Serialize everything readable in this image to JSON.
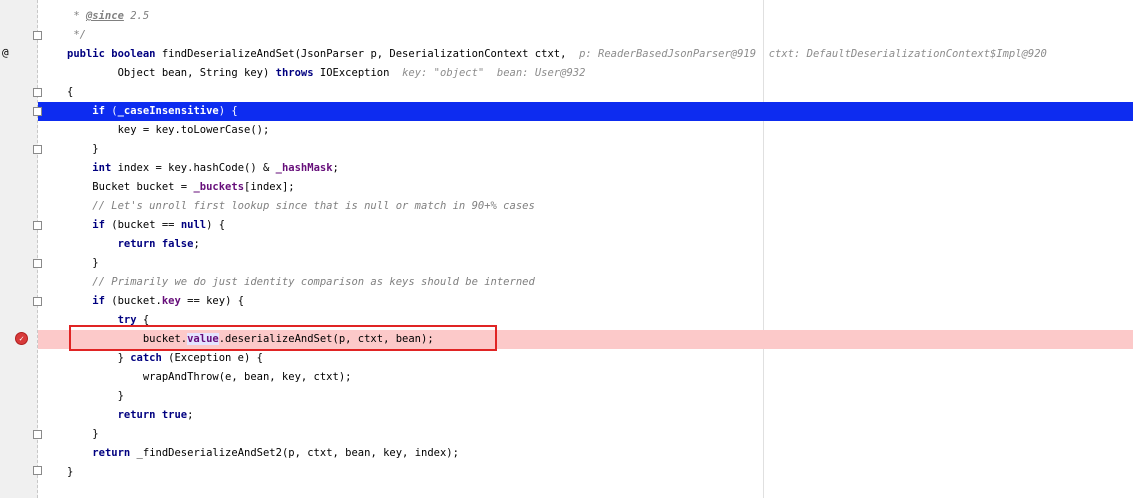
{
  "editor": {
    "gutter": {
      "override_icon": "@",
      "breakpoint_icon": "breakpoint-check-icon"
    },
    "lines": [
      {
        "parts": [
          [
            "cm",
            " * "
          ],
          [
            "doctag",
            "@since"
          ],
          [
            "cm",
            " 2.5"
          ]
        ]
      },
      {
        "parts": [
          [
            "cm",
            " */"
          ]
        ]
      },
      {
        "parts": [
          [
            "kw",
            "public boolean"
          ],
          [
            "t",
            " findDeserializeAndSet(JsonParser p, DeserializationContext ctxt,  "
          ],
          [
            "hint",
            "p: ReaderBasedJsonParser@919  ctxt: DefaultDeserializationContext$Impl@920"
          ]
        ]
      },
      {
        "parts": [
          [
            "t",
            "        Object bean, String key) "
          ],
          [
            "kw",
            "throws"
          ],
          [
            "t",
            " IOException  "
          ],
          [
            "hint",
            "key: \"object\"  bean: User@932"
          ]
        ]
      },
      {
        "parts": [
          [
            "t",
            "{"
          ]
        ]
      },
      {
        "parts": [
          [
            "t",
            "    "
          ],
          [
            "kw",
            "if"
          ],
          [
            "t",
            " ("
          ],
          [
            "field",
            "_caseInsensitive"
          ],
          [
            "t",
            ") {"
          ]
        ]
      },
      {
        "parts": [
          [
            "t",
            "        key = key.toLowerCase();"
          ]
        ]
      },
      {
        "parts": [
          [
            "t",
            "    }"
          ]
        ]
      },
      {
        "parts": [
          [
            "t",
            "    "
          ],
          [
            "kw",
            "int"
          ],
          [
            "t",
            " index = key.hashCode() & "
          ],
          [
            "field",
            "_hashMask"
          ],
          [
            "t",
            ";"
          ]
        ]
      },
      {
        "parts": [
          [
            "t",
            "    Bucket bucket = "
          ],
          [
            "field",
            "_buckets"
          ],
          [
            "t",
            "[index];"
          ]
        ]
      },
      {
        "parts": [
          [
            "cm",
            "    // Let's unroll first lookup since that is null or match in 90+% cases"
          ]
        ]
      },
      {
        "parts": [
          [
            "t",
            "    "
          ],
          [
            "kw",
            "if"
          ],
          [
            "t",
            " (bucket == "
          ],
          [
            "kw",
            "null"
          ],
          [
            "t",
            ") {"
          ]
        ]
      },
      {
        "parts": [
          [
            "t",
            "        "
          ],
          [
            "kw",
            "return false"
          ],
          [
            "t",
            ";"
          ]
        ]
      },
      {
        "parts": [
          [
            "t",
            "    }"
          ]
        ]
      },
      {
        "parts": [
          [
            "cm",
            "    // Primarily we do just identity comparison as keys should be interned"
          ]
        ]
      },
      {
        "parts": [
          [
            "t",
            "    "
          ],
          [
            "kw",
            "if"
          ],
          [
            "t",
            " (bucket."
          ],
          [
            "field",
            "key"
          ],
          [
            "t",
            " == key) {"
          ]
        ]
      },
      {
        "parts": [
          [
            "t",
            "        "
          ],
          [
            "kw",
            "try"
          ],
          [
            "t",
            " {"
          ]
        ]
      },
      {
        "parts": [
          [
            "t",
            "            bucket."
          ],
          [
            "hlfield",
            "value"
          ],
          [
            "t",
            ".deserializeAndSet(p, ctxt, bean);"
          ]
        ]
      },
      {
        "parts": [
          [
            "t",
            "        } "
          ],
          [
            "kw",
            "catch"
          ],
          [
            "t",
            " (Exception e) {"
          ]
        ]
      },
      {
        "parts": [
          [
            "t",
            "            wrapAndThrow(e, bean, key, ctxt);"
          ]
        ]
      },
      {
        "parts": [
          [
            "t",
            "        }"
          ]
        ]
      },
      {
        "parts": [
          [
            "t",
            "        "
          ],
          [
            "kw",
            "return true"
          ],
          [
            "t",
            ";"
          ]
        ]
      },
      {
        "parts": [
          [
            "t",
            "    }"
          ]
        ]
      },
      {
        "parts": [
          [
            "t",
            "    "
          ],
          [
            "kw",
            "return"
          ],
          [
            "t",
            " _findDeserializeAndSet2(p, ctxt, bean, key, index);"
          ]
        ]
      },
      {
        "parts": [
          [
            "t",
            "}"
          ]
        ]
      }
    ]
  }
}
